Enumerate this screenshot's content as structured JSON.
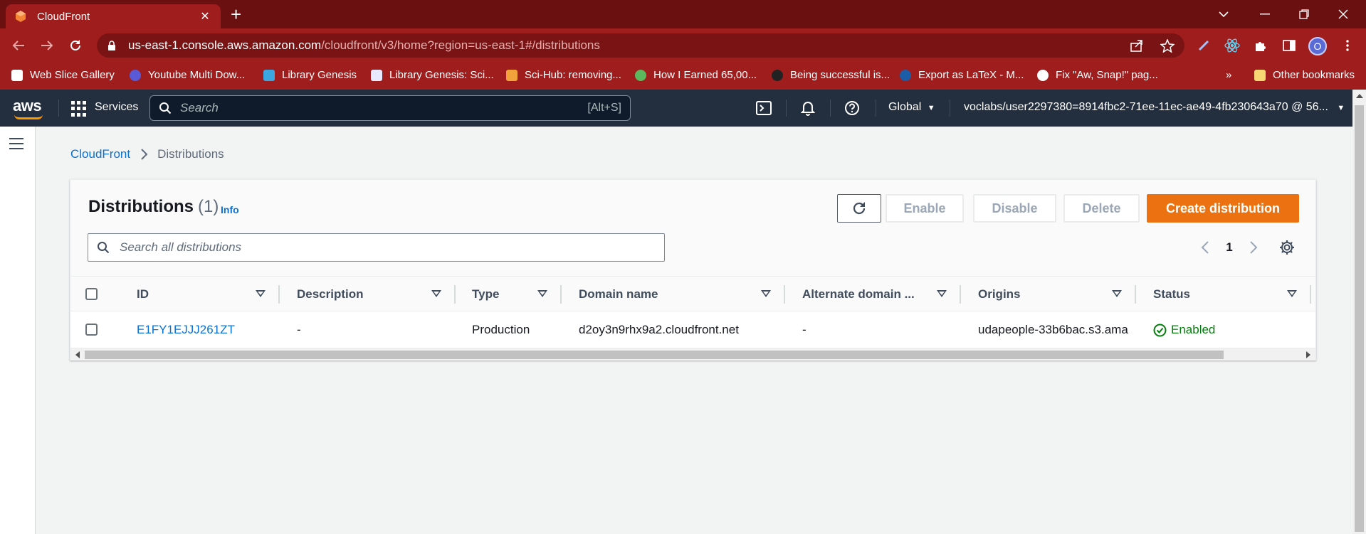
{
  "browser": {
    "tab_title": "CloudFront",
    "url_host": "us-east-1.console.aws.amazon.com",
    "url_path": "/cloudfront/v3/home?region=us-east-1#/distributions",
    "profile_initial": "O",
    "bookmarks": [
      {
        "label": "Web Slice Gallery",
        "icon": "web-slice-icon"
      },
      {
        "label": "Youtube Multi Dow...",
        "icon": "youtube-icon"
      },
      {
        "label": "Library Genesis",
        "icon": "library-genesis-icon"
      },
      {
        "label": "Library Genesis: Sci...",
        "icon": "library-genesis-sci-icon"
      },
      {
        "label": "Sci-Hub: removing...",
        "icon": "sci-hub-icon"
      },
      {
        "label": "How I Earned 65,00...",
        "icon": "leaf-icon"
      },
      {
        "label": "Being successful is...",
        "icon": "telegraph-icon"
      },
      {
        "label": "Export as LaTeX - M...",
        "icon": "gear-blue-icon"
      },
      {
        "label": "Fix \"Aw, Snap!\" pag...",
        "icon": "google-icon"
      }
    ],
    "more_bookmarks": "»",
    "other_bookmarks": "Other bookmarks"
  },
  "aws_header": {
    "logo": "aws",
    "services": "Services",
    "search_placeholder": "Search",
    "search_shortcut": "[Alt+S]",
    "region": "Global",
    "account": "voclabs/user2297380=8914fbc2-71ee-11ec-ae49-4fb230643a70 @ 56..."
  },
  "breadcrumb": {
    "root": "CloudFront",
    "current": "Distributions"
  },
  "distributions": {
    "title": "Distributions",
    "count": "(1)",
    "info": "Info",
    "buttons": {
      "enable": "Enable",
      "disable": "Disable",
      "delete": "Delete",
      "create": "Create distribution"
    },
    "search_placeholder": "Search all distributions",
    "page": "1",
    "columns": [
      "ID",
      "Description",
      "Type",
      "Domain name",
      "Alternate domain ...",
      "Origins",
      "Status"
    ],
    "rows": [
      {
        "id": "E1FY1EJJJ261ZT",
        "description": "-",
        "type": "Production",
        "domain": "d2oy3n9rhx9a2.cloudfront.net",
        "alternate": "-",
        "origins": "udapeople-33b6bac.s3.ama",
        "status": "Enabled"
      }
    ]
  },
  "colors": {
    "browser_frame": "#a01d1d",
    "aws_nav": "#232f3e",
    "primary_button": "#ec7211",
    "link": "#0972d3",
    "status_ok": "#037f0c"
  }
}
